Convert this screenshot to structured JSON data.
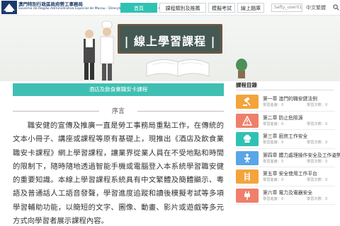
{
  "header": {
    "org_line1": "澳門特別行政區政府勞工事務局",
    "org_line2": "Governo da Região Administrativa Especial de Macau · Direcção dos Serviços para os Assuntos Laborais",
    "nav": [
      {
        "label": "首頁",
        "active": true
      },
      {
        "label": "課程類別及推薦",
        "active": false
      },
      {
        "label": "模擬考試",
        "active": false
      },
      {
        "label": "線上題庫",
        "active": false
      }
    ],
    "user_label": "Safty_user01",
    "language": "中文繁體",
    "icons": {
      "search": "search-icon",
      "logo": "dsal-logo"
    }
  },
  "banner": {
    "title": "| 線上學習課程 |",
    "colors": {
      "board": "#455954",
      "frame": "#6b5642"
    }
  },
  "course": {
    "name": "酒店及飲食業職安卡課程",
    "section_title": "序言",
    "intro": "職安健的宣傳及推廣一直是勞工事務局重點工作，在傳統的文本小冊子、講座或課程等原有基礎上，現推出《酒店及飲食業職安卡課程》網上學習課程，讓業界從業人員在不受地點和時間的限制下，隨時隨地透過智能手機或電腦登入本系統學習職安健的重要知識。本線上學習課程系統具有中文繁體及簡體顯示、粵語及普通話人工語音發聲，學習進度追蹤和讀後模擬考試等多項學習輔助功能，以簡短的文字、圖像、動畫、影片或遊戲等多元方式向學習者展示課程內容。"
  },
  "sidebar": {
    "title": "課程目錄",
    "items": [
      {
        "title": "第一章 澳門的職安健法例",
        "progress": "學習進度：0",
        "count": "學習次數：0",
        "color": "#f3a43b",
        "icon": "gavel-icon"
      },
      {
        "title": "第二章 防止危險源",
        "progress": "學習進度：0",
        "count": "學習次數：0",
        "color": "#ef7f6a",
        "icon": "warning-icon"
      },
      {
        "title": "第三章 廚房工作安全",
        "progress": "學習進度：0",
        "count": "學習次數：0",
        "color": "#2fc2b3",
        "icon": "chef-hat-icon"
      },
      {
        "title": "第四章 體力處理操作安全及工作姿勢",
        "progress": "學習進度：0",
        "count": "學習次數：0",
        "color": "#5aa6e6",
        "icon": "lifting-icon"
      },
      {
        "title": "第五章 安全使用工作平台",
        "progress": "學習進度：0",
        "count": "學習次數：0",
        "color": "#f3a43b",
        "icon": "ladder-icon"
      },
      {
        "title": "第六章 電力及電器安全",
        "progress": "學習進度：0",
        "count": "學習次數：0",
        "color": "#ef7f6a",
        "icon": "plug-icon"
      }
    ]
  }
}
